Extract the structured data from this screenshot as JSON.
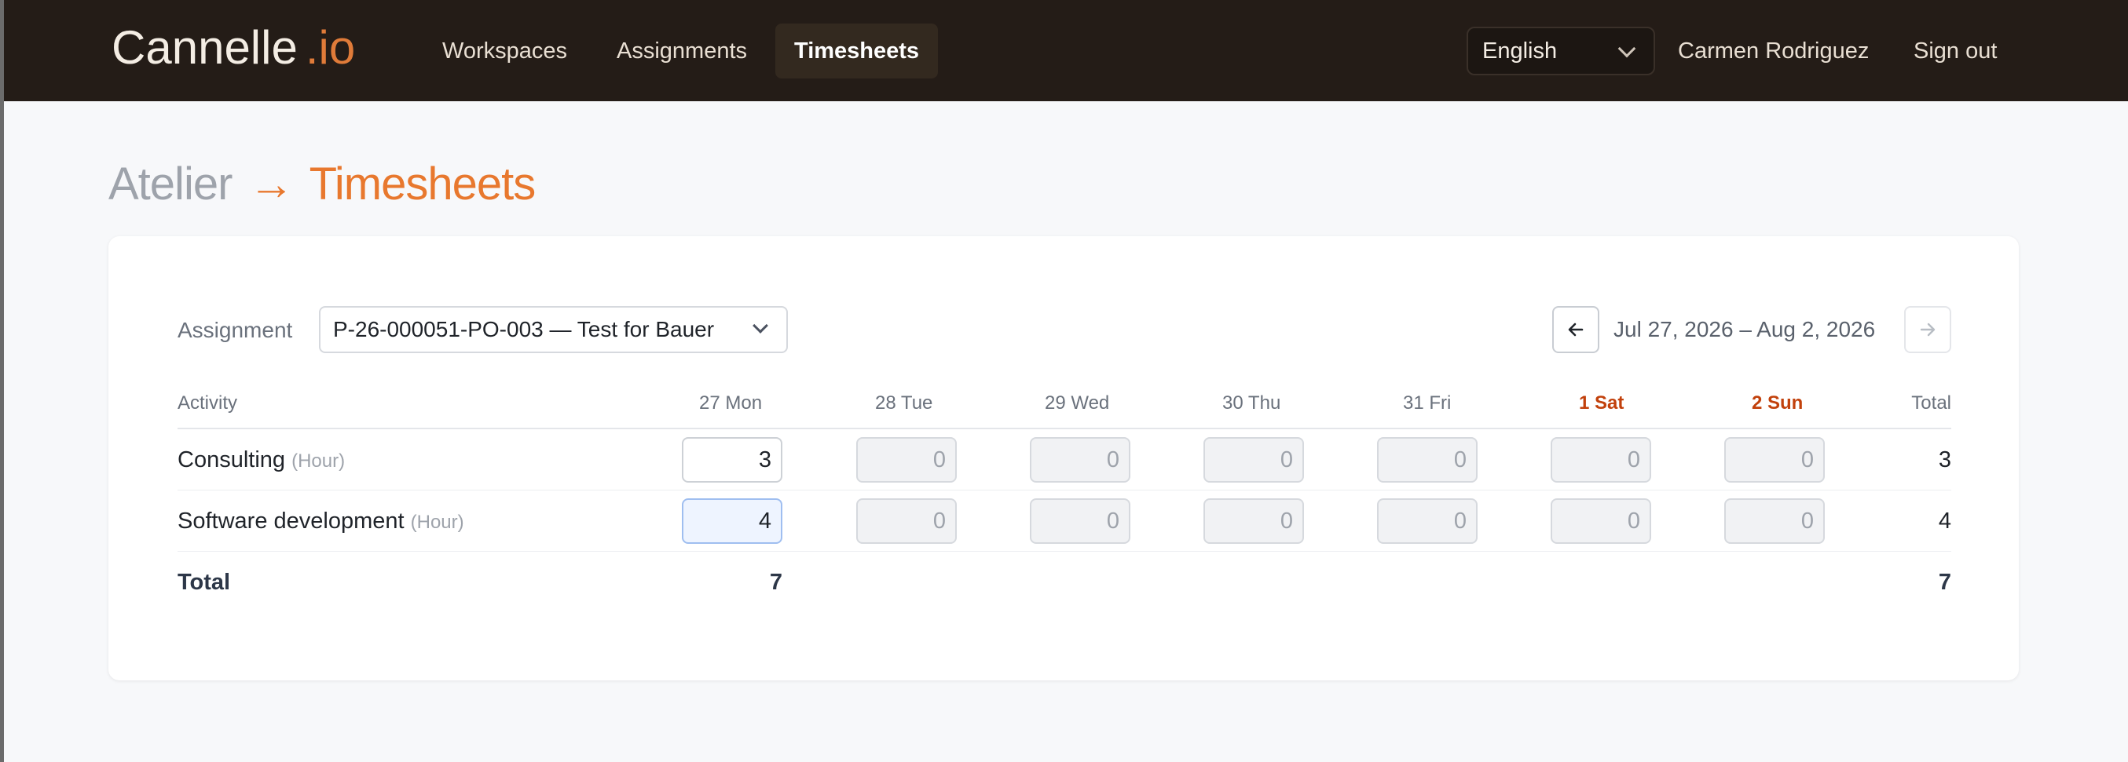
{
  "brand": {
    "name": "Cannelle",
    "suffix": ".io"
  },
  "nav": {
    "links": [
      "Workspaces",
      "Assignments",
      "Timesheets"
    ],
    "active": "Timesheets",
    "language": "English",
    "user": "Carmen Rodriguez",
    "sign_out": "Sign out"
  },
  "page": {
    "breadcrumb_parent": "Atelier",
    "arrow": "→",
    "title": "Timesheets"
  },
  "filter": {
    "assignment_label": "Assignment",
    "assignment_value": "P-26-000051-PO-003 — Test for Bauer",
    "week_range": "Jul 27, 2026 – Aug 2, 2026"
  },
  "table": {
    "headers": {
      "activity": "Activity",
      "days": [
        "27 Mon",
        "28 Tue",
        "29 Wed",
        "30 Thu",
        "31 Fri",
        "1 Sat",
        "2 Sun"
      ],
      "total": "Total"
    },
    "rows": [
      {
        "activity": "Consulting",
        "unit": "(Hour)",
        "values": [
          "3",
          "0",
          "0",
          "0",
          "0",
          "0",
          "0"
        ],
        "total": "3"
      },
      {
        "activity": "Software development",
        "unit": "(Hour)",
        "values": [
          "4",
          "0",
          "0",
          "0",
          "0",
          "0",
          "0"
        ],
        "total": "4"
      }
    ],
    "footer": {
      "label": "Total",
      "day_total": "7",
      "grand_total": "7"
    }
  },
  "colors": {
    "accent": "#e8782e",
    "navbar": "#241c17",
    "weekend": "#c2410c"
  }
}
